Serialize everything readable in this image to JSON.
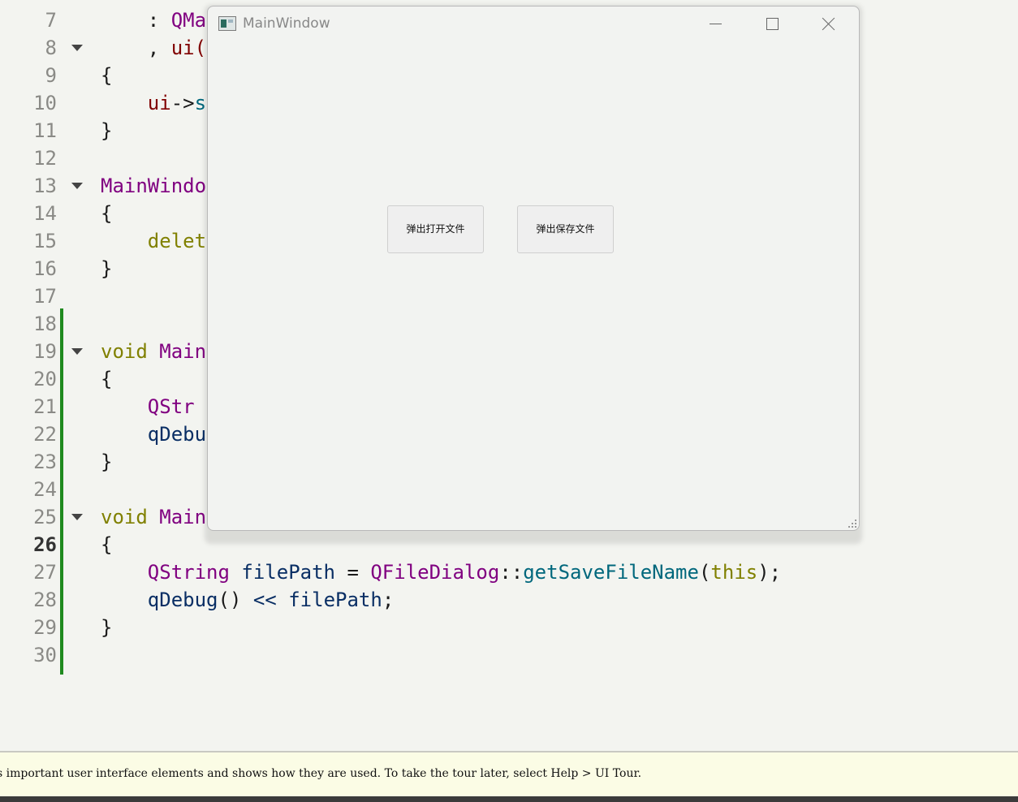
{
  "editor": {
    "current_line": "26",
    "lines": [
      {
        "num": "7",
        "tokens": [
          [
            "pc",
            "    : "
          ],
          [
            "ty",
            "QMa"
          ]
        ]
      },
      {
        "num": "8",
        "fold": true,
        "tokens": [
          [
            "pc",
            "    , "
          ],
          [
            "mem",
            "ui("
          ]
        ]
      },
      {
        "num": "9",
        "tokens": [
          [
            "pc",
            "{"
          ]
        ]
      },
      {
        "num": "10",
        "tokens": [
          [
            "mem",
            "    ui"
          ],
          [
            "pc",
            "->"
          ],
          [
            "fn",
            "s"
          ]
        ]
      },
      {
        "num": "11",
        "tokens": [
          [
            "pc",
            "}"
          ]
        ]
      },
      {
        "num": "12",
        "tokens": []
      },
      {
        "num": "13",
        "fold": true,
        "tokens": [
          [
            "ty",
            "MainWindo"
          ]
        ]
      },
      {
        "num": "14",
        "tokens": [
          [
            "pc",
            "{"
          ]
        ]
      },
      {
        "num": "15",
        "tokens": [
          [
            "kw",
            "    delet"
          ]
        ]
      },
      {
        "num": "16",
        "tokens": [
          [
            "pc",
            "}"
          ]
        ]
      },
      {
        "num": "17",
        "tokens": []
      },
      {
        "num": "18",
        "tokens": []
      },
      {
        "num": "19",
        "fold": true,
        "tokens": [
          [
            "kw",
            "void"
          ],
          [
            "pc",
            " "
          ],
          [
            "ty",
            "Main"
          ]
        ]
      },
      {
        "num": "20",
        "tokens": [
          [
            "pc",
            "{"
          ]
        ]
      },
      {
        "num": "21",
        "tokens": [
          [
            "ty",
            "    QStr"
          ]
        ]
      },
      {
        "num": "22",
        "tokens": [
          [
            "id",
            "    qDebu"
          ]
        ]
      },
      {
        "num": "23",
        "tokens": [
          [
            "pc",
            "}"
          ]
        ]
      },
      {
        "num": "24",
        "tokens": []
      },
      {
        "num": "25",
        "fold": true,
        "tokens": [
          [
            "kw",
            "void"
          ],
          [
            "pc",
            " "
          ],
          [
            "ty",
            "Main"
          ]
        ]
      },
      {
        "num": "26",
        "tokens": [
          [
            "pc",
            "{"
          ]
        ]
      },
      {
        "num": "27",
        "tokens": [
          [
            "ty",
            "    QString"
          ],
          [
            "pc",
            " "
          ],
          [
            "id",
            "filePath"
          ],
          [
            "pc",
            " = "
          ],
          [
            "ty",
            "QFileDialog"
          ],
          [
            "pc",
            "::"
          ],
          [
            "fn",
            "getSaveFileName"
          ],
          [
            "pc",
            "("
          ],
          [
            "kw",
            "this"
          ],
          [
            "pc",
            ");"
          ]
        ]
      },
      {
        "num": "28",
        "tokens": [
          [
            "id",
            "    qDebug"
          ],
          [
            "pc",
            "() "
          ],
          [
            "id",
            "<<"
          ],
          [
            "pc",
            " "
          ],
          [
            "id",
            "filePath"
          ],
          [
            "pc",
            ";"
          ]
        ]
      },
      {
        "num": "29",
        "tokens": [
          [
            "pc",
            "}"
          ]
        ]
      },
      {
        "num": "30",
        "tokens": []
      }
    ]
  },
  "window": {
    "title": "MainWindow",
    "button_open": "弹出打开文件",
    "button_save": "弹出保存文件"
  },
  "status": {
    "text": "s important user interface elements and shows how they are used. To take the tour later, select Help > UI Tour."
  }
}
